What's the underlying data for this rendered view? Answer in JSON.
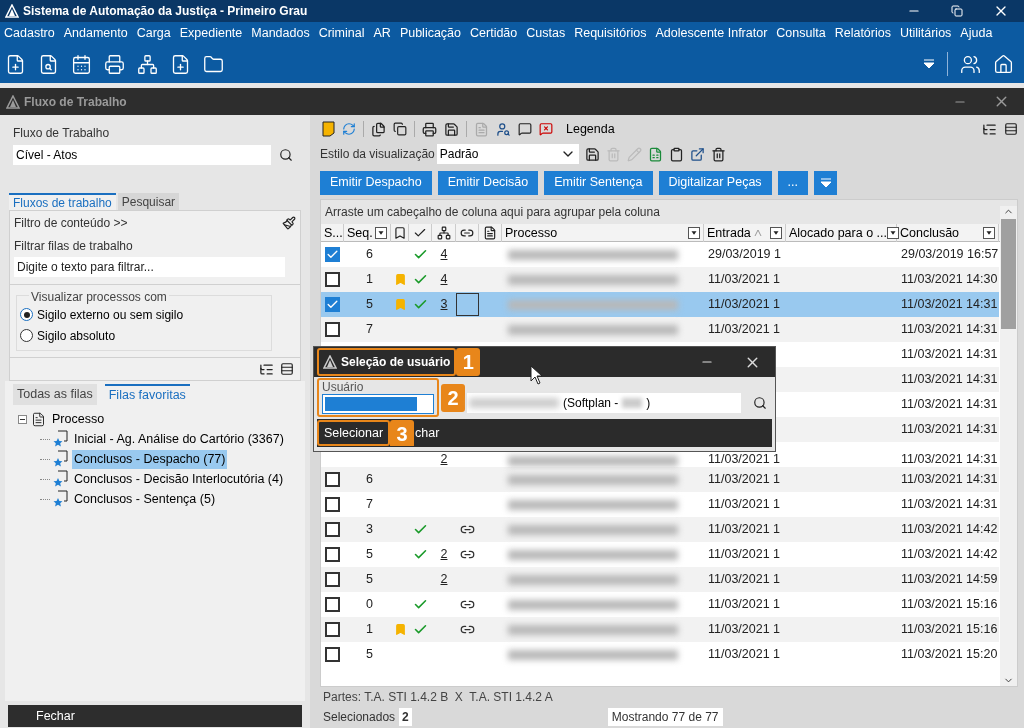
{
  "app": {
    "title": "Sistema de Automação da Justiça - Primeiro Grau"
  },
  "menu": [
    "Cadastro",
    "Andamento",
    "Carga",
    "Expediente",
    "Mandados",
    "Criminal",
    "AR",
    "Publicação",
    "Certidão",
    "Custas",
    "Requisitórios",
    "Adolescente Infrator",
    "Consulta",
    "Relatórios",
    "Utilitários",
    "Ajuda"
  ],
  "inner_window": {
    "title": "Fluxo de Trabalho"
  },
  "left": {
    "workflow_label": "Fluxo de Trabalho",
    "workflow_value": "Cível - Atos",
    "tabs": [
      {
        "label": "Fluxos de trabalho",
        "selected": true
      },
      {
        "label": "Pesquisar",
        "selected": false
      }
    ],
    "filter_toggle": "Filtro de conteúdo >>",
    "filter_label": "Filtrar filas de trabalho",
    "filter_placeholder": "Digite o texto para filtrar...",
    "group_title": "Visualizar processos com",
    "radios": [
      {
        "label": "Sigilo externo ou sem sigilo",
        "selected": true
      },
      {
        "label": "Sigilo absoluto",
        "selected": false
      }
    ],
    "queue_tabs": [
      {
        "label": "Todas as filas",
        "selected": false
      },
      {
        "label": "Filas favoritas",
        "selected": true
      }
    ],
    "tree": [
      {
        "label": "Processo",
        "expanded": true,
        "selected": false,
        "children": [
          {
            "label": "Inicial - Ag. Análise do Cartório (3367)",
            "selected": false
          },
          {
            "label": "Conclusos - Despacho (77)",
            "selected": true
          },
          {
            "label": "Conclusos - Decisão Interlocutória (4)",
            "selected": false
          },
          {
            "label": "Conclusos - Sentença (5)",
            "selected": false
          }
        ]
      }
    ],
    "close_button": "Fechar"
  },
  "main": {
    "legend": "Legenda",
    "view_style_label": "Estilo da visualização",
    "view_style_value": "Padrão",
    "actions": [
      "Emitir Despacho",
      "Emitir Decisão",
      "Emitir Sentença",
      "Digitalizar Peças",
      "..."
    ],
    "group_hint": "Arraste um cabeçalho de coluna aqui para agrupar pela coluna",
    "columns": [
      {
        "kind": "text",
        "label": "S...",
        "filter": false,
        "sorted": false
      },
      {
        "kind": "text",
        "label": "Seq.",
        "filter": true,
        "sorted": false
      },
      {
        "kind": "bookmark"
      },
      {
        "kind": "check"
      },
      {
        "kind": "tree"
      },
      {
        "kind": "link"
      },
      {
        "kind": "doc"
      },
      {
        "kind": "text",
        "label": "Processo",
        "filter": true,
        "sorted": false
      },
      {
        "kind": "text",
        "label": "Entrada",
        "filter": true,
        "sorted": true
      },
      {
        "kind": "text",
        "label": "Alocado para o ...",
        "filter": true,
        "sorted": false
      },
      {
        "kind": "text",
        "label": "Conclusão",
        "filter": true,
        "sorted": false
      }
    ],
    "rows": [
      {
        "checked": true,
        "selected": false,
        "seq": "6",
        "bookmarked": false,
        "done": true,
        "count": "4",
        "linked": false,
        "focused": false,
        "entrada": "29/03/2019 1",
        "conclusao": "29/03/2019 16:57"
      },
      {
        "checked": false,
        "selected": false,
        "seq": "1",
        "bookmarked": true,
        "done": true,
        "count": "4",
        "linked": false,
        "focused": false,
        "entrada": "11/03/2021 1",
        "conclusao": "11/03/2021 14:30"
      },
      {
        "checked": true,
        "selected": true,
        "seq": "5",
        "bookmarked": true,
        "done": true,
        "count": "3",
        "linked": false,
        "focused": true,
        "entrada": "11/03/2021 1",
        "conclusao": "11/03/2021 14:31"
      },
      {
        "checked": false,
        "selected": false,
        "seq": "7",
        "bookmarked": false,
        "done": false,
        "linked": false,
        "focused": false,
        "entrada": "11/03/2021 1",
        "conclusao": "11/03/2021 14:31"
      },
      {
        "conclusao": "11/03/2021 14:31"
      },
      {
        "conclusao": "11/03/2021 14:31"
      },
      {
        "conclusao": "11/03/2021 14:31"
      },
      {
        "conclusao": "11/03/2021 14:31"
      },
      {
        "count": "2",
        "entrada": "11/03/2021 1",
        "conclusao": "11/03/2021 14:31"
      },
      {
        "checked": false,
        "selected": false,
        "seq": "6",
        "bookmarked": false,
        "done": false,
        "linked": false,
        "focused": false,
        "entrada": "11/03/2021 1",
        "conclusao": "11/03/2021 14:31"
      },
      {
        "checked": false,
        "selected": false,
        "seq": "7",
        "bookmarked": false,
        "done": false,
        "linked": false,
        "focused": false,
        "entrada": "11/03/2021 1",
        "conclusao": "11/03/2021 14:31"
      },
      {
        "checked": false,
        "selected": false,
        "seq": "3",
        "bookmarked": false,
        "done": true,
        "linked": true,
        "focused": false,
        "entrada": "11/03/2021 1",
        "conclusao": "11/03/2021 14:42"
      },
      {
        "checked": false,
        "selected": false,
        "seq": "5",
        "bookmarked": false,
        "done": true,
        "count": "2",
        "linked": true,
        "focused": false,
        "entrada": "11/03/2021 1",
        "conclusao": "11/03/2021 14:42"
      },
      {
        "checked": false,
        "selected": false,
        "seq": "5",
        "bookmarked": false,
        "done": false,
        "count": "2",
        "linked": false,
        "focused": false,
        "entrada": "11/03/2021 1",
        "conclusao": "11/03/2021 14:59"
      },
      {
        "checked": false,
        "selected": false,
        "seq": "0",
        "bookmarked": false,
        "done": true,
        "linked": true,
        "focused": false,
        "entrada": "11/03/2021 1",
        "conclusao": "11/03/2021 15:16"
      },
      {
        "checked": false,
        "selected": false,
        "seq": "1",
        "bookmarked": true,
        "done": true,
        "linked": true,
        "focused": false,
        "entrada": "11/03/2021 1",
        "conclusao": "11/03/2021 15:16"
      },
      {
        "checked": false,
        "selected": false,
        "seq": "5",
        "bookmarked": false,
        "done": false,
        "linked": false,
        "focused": false,
        "entrada": "11/03/2021 1",
        "conclusao": "11/03/2021 15:20"
      }
    ],
    "parts": "Partes: T.A. STI 1.4.2 B  X  T.A. STI 1.4.2 A",
    "selected_label": "Selecionados",
    "selected_count": "2",
    "showing": "Mostrando 77 de 77"
  },
  "dialog": {
    "title": "Seleção de usuário",
    "field_label": "Usuário",
    "user_suffix": "(Softplan -",
    "user_suffix_end": ")",
    "select_button": "Selecionar",
    "close_button": "char",
    "annotations": [
      "1",
      "2",
      "3"
    ]
  }
}
